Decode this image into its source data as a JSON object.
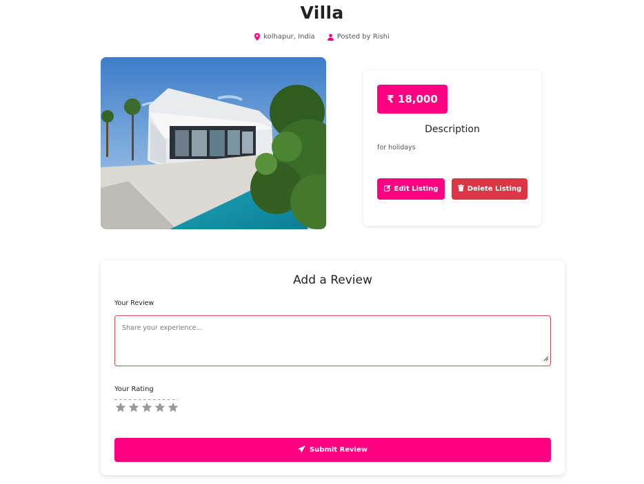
{
  "listing": {
    "title": "Villa",
    "location": "kolhapur, India",
    "posted_by": "Posted by Rishi",
    "price": "₹ 18,000",
    "description_heading": "Description",
    "description": "for holidays",
    "edit_label": "Edit Listing",
    "delete_label": "Delete Listing"
  },
  "review_form": {
    "title": "Add a Review",
    "review_label": "Your Review",
    "review_placeholder": "Share your experience...",
    "rating_label": "Your Rating",
    "rating_value": 0,
    "rating_max": 5,
    "submit_label": "Submit Review"
  },
  "icons": {
    "location": "map-pin-icon",
    "user": "user-icon",
    "edit": "edit-icon",
    "delete": "trash-icon",
    "star": "star-icon",
    "submit": "paper-plane-icon"
  },
  "colors": {
    "accent": "#ff0080",
    "danger": "#dc3545",
    "star_inactive": "#9a9a9a"
  }
}
